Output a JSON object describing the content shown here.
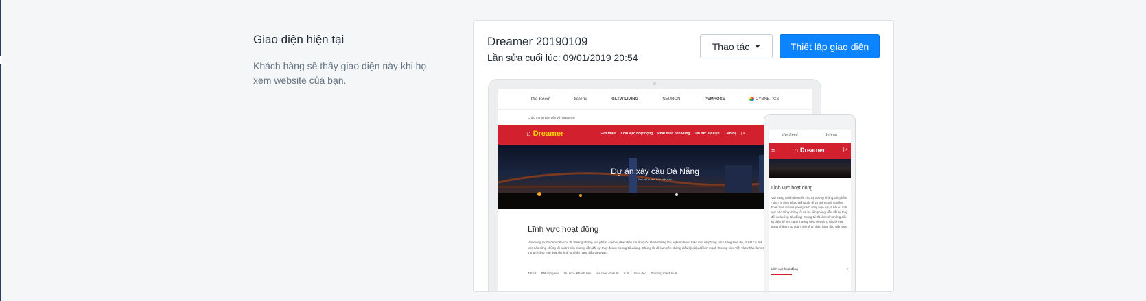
{
  "left_section": {
    "title": "Giao diện hiện tại",
    "description": "Khách hàng sẽ thấy giao diện này khi họ xem website của bạn."
  },
  "theme": {
    "name": "Dreamer 20190109",
    "last_edited": "Lần sửa cuối lúc: 09/01/2019 20:54"
  },
  "buttons": {
    "actions_label": "Thao tác",
    "setup_label": "Thiết lập giao diện",
    "setup_color": "#0d84ff"
  },
  "preview": {
    "partner_logos": [
      "the Reed",
      "Yelena",
      "GLTW LIVING",
      "NEURON",
      "PEMROSE",
      "CYBNETICS"
    ],
    "welcome": "Chào mừng bạn đến với Dreamer!",
    "site_logo": "Dreamer",
    "nav_items": [
      "Giới thiệu",
      "Lĩnh vực hoạt động",
      "Phát triển bền vững",
      "Tin tức sự kiện",
      "Liên hệ"
    ],
    "hero_title": "Dự án xây cầu Đà Nẵng",
    "hero_subtitle": "Nơi hội tụ tinh hoa kiến trúc",
    "activity_title": "Lĩnh vực hoạt động",
    "activity_text": "Với mong muốn đem đến cho thị trường những sản phẩm - dịch vụ theo tiêu chuẩn quốc tế và những trải nghiệm hoàn toàn mới về phong cách sống hiện đại, ở bất cứ lĩnh vực nào công chúng tôi vai trò tiên phong, dẫn dắt sự thay đổi xu hướng tiêu dùng. Chúng tôi đã làm nên những điều kỳ diệu để lớn mạnh thương hiệu Việt và tự hào là một trong những Tập đoàn kinh tế tư nhân hàng đầu Việt Nam.",
    "categories": [
      "Tất cả",
      "Bất động sản",
      "Du lịch - Khách sạn",
      "Vui chơi - Giải trí",
      "Y tế",
      "Giáo dục",
      "Thương mại Bán lẻ"
    ],
    "mobile_dropdown": "Lĩnh vực hoạt động",
    "accent_color": "#d3202e"
  }
}
